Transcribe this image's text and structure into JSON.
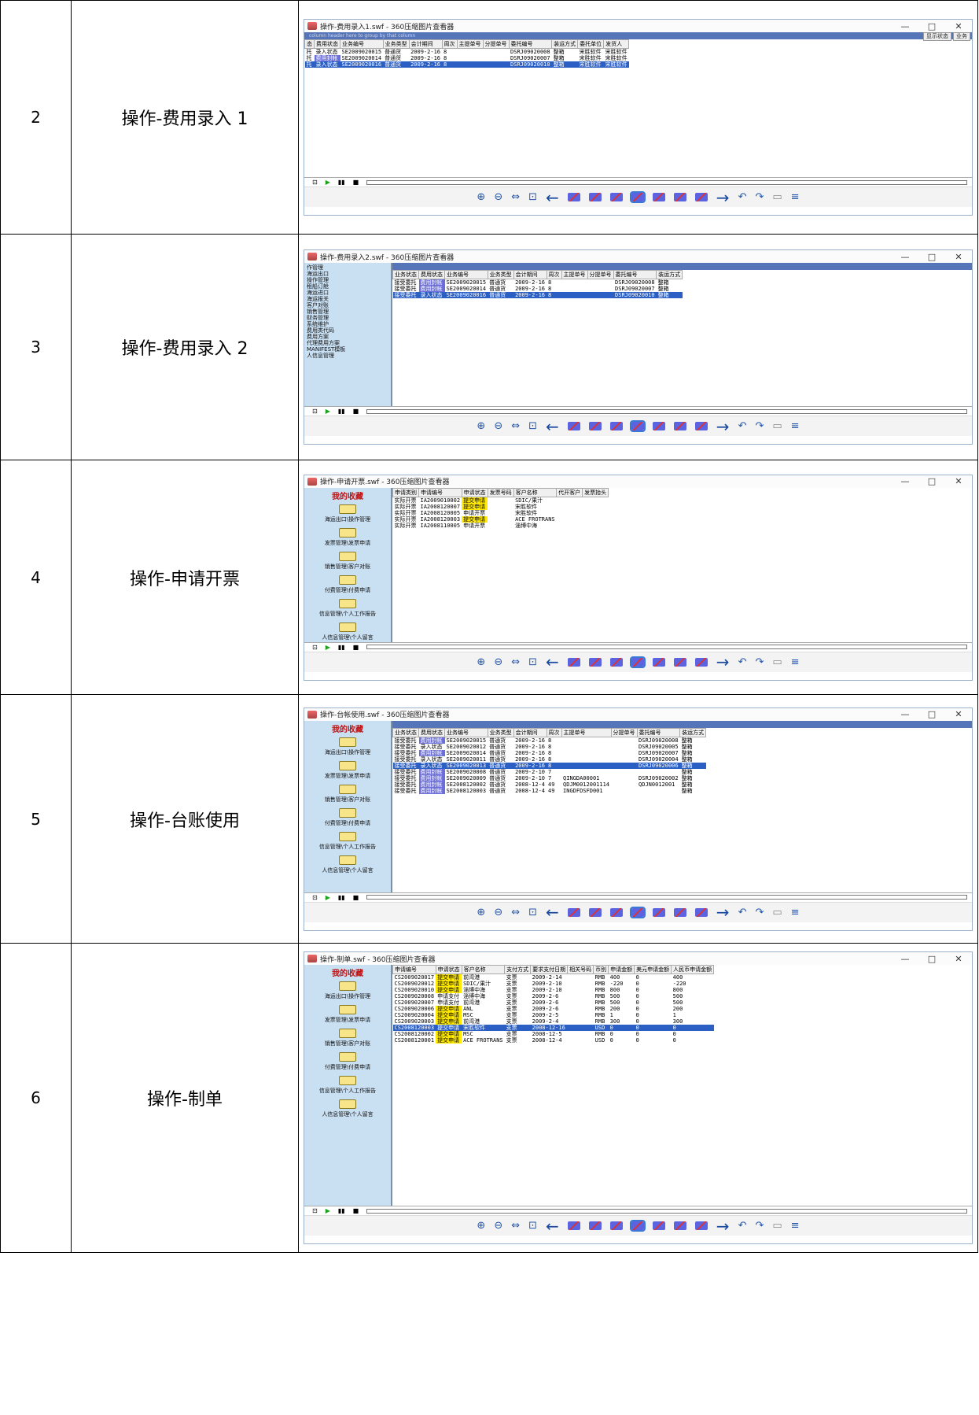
{
  "rows": [
    {
      "num": "2",
      "title": "操作-费用录入 1"
    },
    {
      "num": "3",
      "title": "操作-费用录入 2"
    },
    {
      "num": "4",
      "title": "操作-申请开票"
    },
    {
      "num": "5",
      "title": "操作-台账使用"
    },
    {
      "num": "6",
      "title": "操作-制单"
    }
  ],
  "screens": {
    "s1": {
      "window_title": "操作-费用录入1.swf - 360压缩图片查看器",
      "group_hint": "column header here to group by that column",
      "headers": [
        "态",
        "费用状态",
        "业务编号",
        "业务类型",
        "会计期间",
        "周次",
        "主提单号",
        "分提单号",
        "委托编号",
        "装运方式",
        "委托单位",
        "发货人"
      ],
      "rows": [
        [
          "托",
          "录入状态",
          "SE2009020015",
          "普通货",
          "2009-2-16",
          "8",
          "",
          "",
          "DSRJ09020008",
          "整箱",
          "宋胜软件",
          "宋胜软件"
        ],
        [
          "托",
          "费用封帐",
          "SE2009020014",
          "普通货",
          "2009-2-16",
          "8",
          "",
          "",
          "DSRJ09020007",
          "整箱",
          "宋胜软件",
          "宋胜软件"
        ],
        [
          "托",
          "录入状态",
          "SE2009020016",
          "普通货",
          "2009-2-16",
          "8",
          "",
          "",
          "DSRJ09020010",
          "整箱",
          "宋胜软件",
          "宋胜软件"
        ]
      ],
      "btn_status": "显示状态",
      "btn_business": "业务"
    },
    "s2": {
      "window_title": "操作-费用录入2.swf - 360压缩图片查看器",
      "tree": [
        "作管理",
        "海运出口",
        "操作管理",
        "租船订舱",
        "海运进口",
        "海运报关",
        "客户对账",
        "销售管理",
        "财务管理",
        "系统维护",
        "费用类代码",
        "费用方案",
        "代理费用方案",
        "MANIFEST模板",
        "人信息管理"
      ],
      "headers": [
        "业务状态",
        "费用状态",
        "业务编号",
        "业务类型",
        "会计期间",
        "周次",
        "主提单号",
        "分提单号",
        "委托编号",
        "装运方式"
      ],
      "rows": [
        [
          "接受委托",
          "费用封帐",
          "SE2009020015",
          "普通货",
          "2009-2-16",
          "8",
          "",
          "",
          "DSRJ09020008",
          "整箱"
        ],
        [
          "接受委托",
          "费用封帐",
          "SE2009020014",
          "普通货",
          "2009-2-16",
          "8",
          "",
          "",
          "DSRJ09020007",
          "整箱"
        ],
        [
          "接受委托",
          "录入状态",
          "SE2009020016",
          "普通货",
          "2009-2-16",
          "8",
          "",
          "",
          "DSRJ09020010",
          "整箱"
        ]
      ]
    },
    "s3": {
      "window_title": "操作-申请开票.swf - 360压缩图片查看器",
      "sidebar_title": "我的收藏",
      "folders": [
        "海运出口\\操作管理",
        "发票管理\\发票申请",
        "销售管理\\客户对账",
        "付费管理\\付费申请",
        "信息管理\\个人工作报告",
        "人信息管理\\个人留言"
      ],
      "headers": [
        "申请类别",
        "申请编号",
        "申请状态",
        "发票号码",
        "客户名称",
        "代开客户",
        "发票抬头"
      ],
      "rows": [
        [
          "实际开票",
          "IA2009010002",
          "提交申请",
          "",
          "SDIC/果汁",
          "",
          ""
        ],
        [
          "实际开票",
          "IA2008120007",
          "提交申请",
          "",
          "宋胜软件",
          "",
          ""
        ],
        [
          "实际开票",
          "IA2008120005",
          "申请开票",
          "",
          "宋胜软件",
          "",
          ""
        ],
        [
          "实际开票",
          "IA2008120003",
          "提交申请",
          "",
          "ACE FROTRANS",
          "",
          ""
        ],
        [
          "实际开票",
          "IA2008110005",
          "申请开票",
          "",
          "淄博中海",
          "",
          ""
        ]
      ]
    },
    "s4": {
      "window_title": "操作-台帐使用.swf - 360压缩图片查看器",
      "sidebar_title": "我的收藏",
      "folders": [
        "海运出口\\操作管理",
        "发票管理\\发票申请",
        "销售管理\\客户对账",
        "付费管理\\付费申请",
        "信息管理\\个人工作报告",
        "人信息管理\\个人留言"
      ],
      "headers": [
        "业务状态",
        "费用状态",
        "业务编号",
        "业务类型",
        "会计期间",
        "周次",
        "主提单号",
        "分提单号",
        "委托编号",
        "装运方式"
      ],
      "rows": [
        [
          "接受委托",
          "费用封帐",
          "SE2009020015",
          "普通货",
          "2009-2-16",
          "8",
          "",
          "",
          "DSRJ09020008",
          "整箱"
        ],
        [
          "接受委托",
          "录入状态",
          "SE2009020012",
          "普通货",
          "2009-2-16",
          "8",
          "",
          "",
          "DSRJ09020005",
          "整箱"
        ],
        [
          "接受委托",
          "费用封帐",
          "SE2009020014",
          "普通货",
          "2009-2-16",
          "8",
          "",
          "",
          "DSRJ09020007",
          "整箱"
        ],
        [
          "接受委托",
          "录入状态",
          "SE2009020011",
          "普通货",
          "2009-2-16",
          "8",
          "",
          "",
          "DSRJ09020004",
          "整箱"
        ],
        [
          "接受委托",
          "录入状态",
          "SE2009020013",
          "普通货",
          "2009-2-16",
          "8",
          "",
          "",
          "DSRJ09020006",
          "整箱"
        ],
        [
          "接受委托",
          "费用封帐",
          "SE2009020008",
          "普通货",
          "2009-2-10",
          "7",
          "",
          "",
          "",
          "整箱"
        ],
        [
          "接受委托",
          "费用封帐",
          "SE2009020009",
          "普通货",
          "2009-2-10",
          "7",
          "QINGDA00001",
          "",
          "DSRJ09020002",
          "整箱"
        ],
        [
          "接受委托",
          "费用封帐",
          "SE2008120002",
          "普通货",
          "2008-12-4",
          "49",
          "QDJM0012001114",
          "",
          "QDJN0012001",
          "整箱"
        ],
        [
          "接受委托",
          "费用封帐",
          "SE2008120003",
          "普通货",
          "2008-12-4",
          "49",
          "INGDFDSFD001",
          "",
          "",
          "整箱"
        ]
      ]
    },
    "s5": {
      "window_title": "操作-制单.swf - 360压缩图片查看器",
      "sidebar_title": "我的收藏",
      "folders": [
        "海运出口\\操作管理",
        "发票管理\\发票申请",
        "销售管理\\客户对账",
        "付费管理\\付费申请",
        "信息管理\\个人工作报告",
        "人信息管理\\个人留言"
      ],
      "headers": [
        "申请编号",
        "申请状态",
        "客户名称",
        "支付方式",
        "要求支付日期",
        "相关号码",
        "币别",
        "申请金额",
        "美元申请金额",
        "人民币申请金额"
      ],
      "rows": [
        [
          "CS2009020017",
          "提交申请",
          "前湾港",
          "支票",
          "2009-2-14",
          "",
          "RMB",
          "400",
          "0",
          "400"
        ],
        [
          "CS2009020012",
          "提交申请",
          "SDIC/果汁",
          "支票",
          "2009-2-10",
          "",
          "RMB",
          "-220",
          "0",
          "-220"
        ],
        [
          "CS2009020010",
          "提交申请",
          "淄博中海",
          "支票",
          "2009-2-10",
          "",
          "RMB",
          "800",
          "0",
          "800"
        ],
        [
          "CS2009020008",
          "申请支付",
          "淄博中海",
          "支票",
          "2009-2-6",
          "",
          "RMB",
          "500",
          "0",
          "500"
        ],
        [
          "CS2009020007",
          "申请支付",
          "前湾港",
          "支票",
          "2009-2-6",
          "",
          "RMB",
          "500",
          "0",
          "500"
        ],
        [
          "CS2009020006",
          "提交申请",
          "ANL",
          "支票",
          "2009-2-6",
          "",
          "RMB",
          "200",
          "0",
          "200"
        ],
        [
          "CS2009020004",
          "提交申请",
          "MSC",
          "支票",
          "2009-2-5",
          "",
          "RMB",
          "1",
          "0",
          "1"
        ],
        [
          "CS2009020003",
          "提交申请",
          "前湾港",
          "支票",
          "2009-2-4",
          "",
          "RMB",
          "300",
          "0",
          "300"
        ],
        [
          "CS2008120003",
          "提交申请",
          "宋胜软件",
          "支票",
          "2008-12-16",
          "",
          "USD",
          "0",
          "0",
          "0"
        ],
        [
          "CS2008120002",
          "提交申请",
          "MSC",
          "支票",
          "2008-12-5",
          "",
          "RMB",
          "0",
          "0",
          "0"
        ],
        [
          "CS2008120001",
          "提交申请",
          "ACE FROTRANS",
          "支票",
          "2008-12-4",
          "",
          "USD",
          "0",
          "0",
          "0"
        ]
      ]
    }
  },
  "toolbar": {
    "zoom_in": "⊕",
    "zoom_out": "⊖",
    "fit": "⇔",
    "screen": "⊡",
    "prev": "←",
    "next": "→",
    "rotate_left": "↶",
    "rotate_right": "↷",
    "delete": "▭",
    "edit": "≡"
  },
  "player": {
    "record": "⊡",
    "play": "▶",
    "pause": "▮▮",
    "stop": "■"
  },
  "window_buttons": {
    "min": "—",
    "max": "□",
    "close": "✕"
  }
}
